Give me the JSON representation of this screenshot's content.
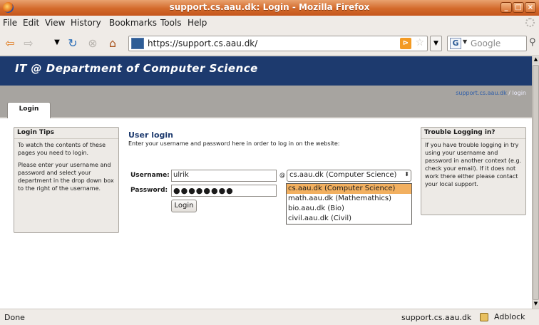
{
  "window": {
    "title": "support.cs.aau.dk: Login - Mozilla Firefox"
  },
  "menu": [
    "File",
    "Edit",
    "View",
    "History",
    "Bookmarks",
    "Tools",
    "Help"
  ],
  "toolbar": {
    "url": "https://support.cs.aau.dk/",
    "search_placeholder": "Google"
  },
  "site": {
    "banner": "IT @ Department of Computer Science",
    "crumb_link": "support.cs.aau.dk",
    "crumb_sep": "/",
    "crumb_current": "login",
    "tab": "Login"
  },
  "left_box": {
    "title": "Login Tips",
    "para1": "To watch the contents of these pages you need to login.",
    "para2": "Please enter your username and password and select your department in the drop down box to the right of the username."
  },
  "right_box": {
    "title": "Trouble Logging in?",
    "para": "If you have trouble logging in try using your username and password in another context (e.g. check your email). If it does not work there either please contact your local support."
  },
  "login": {
    "heading": "User login",
    "intro": "Enter your username and password here in order to log in on the website:",
    "username_label": "Username:",
    "username_value": "ulrik",
    "password_label": "Password:",
    "password_mask": "●●●●●●●●",
    "at": "@",
    "domain_selected": "cs.aau.dk (Computer Science)",
    "domain_options": [
      "cs.aau.dk (Computer Science)",
      "math.aau.dk (Mathemathics)",
      "bio.aau.dk (Bio)",
      "civil.aau.dk (Civil)"
    ],
    "button": "Login"
  },
  "status": {
    "text": "Done",
    "host": "support.cs.aau.dk",
    "adblock": "Adblock"
  }
}
